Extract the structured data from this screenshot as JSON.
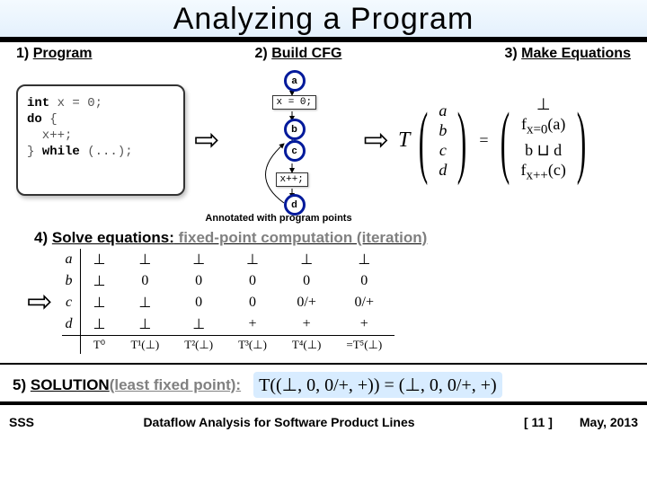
{
  "title": "Analyzing a Program",
  "h1": {
    "num": "1)",
    "text": "Program"
  },
  "h2": {
    "num": "2)",
    "text": "Build CFG"
  },
  "h3": {
    "num": "3)",
    "text": "Make Equations"
  },
  "code": {
    "l1a": "int",
    "l1b": " x = 0;",
    "l2a": "do",
    "l2b": " {",
    "l3": "  x++;",
    "l4a": "} ",
    "l4b": "while",
    "l4c": " (...);"
  },
  "cfg": {
    "labels": {
      "a": "a",
      "b": "b",
      "c": "c",
      "d": "d"
    },
    "stmt1": "x = 0;",
    "stmt2": "x++;"
  },
  "annotated_caption": "Annotated with program points",
  "eq": {
    "T": "T",
    "vec": [
      "a",
      "b",
      "c",
      "d"
    ],
    "equals": "=",
    "rhs": [
      "⊥",
      "f_{x=0}(a)",
      "b ⊔ d",
      "f_{x++}(c)"
    ]
  },
  "h4": {
    "num": "4)",
    "text_a": "Solve equations:",
    "text_b": " fixed-point computation (iteration)"
  },
  "iter": {
    "rows": [
      "a",
      "b",
      "c",
      "d"
    ],
    "data": [
      [
        "⊥",
        "⊥",
        "⊥",
        "⊥",
        "⊥",
        "⊥"
      ],
      [
        "⊥",
        "0",
        "0",
        "0",
        "0",
        "0"
      ],
      [
        "⊥",
        "⊥",
        "0",
        "0",
        "0/+",
        "0/+"
      ],
      [
        "⊥",
        "⊥",
        "⊥",
        "+",
        "+",
        "+"
      ]
    ],
    "collabels": [
      "T⁰",
      "T¹(⊥)",
      "T²(⊥)",
      "T³(⊥)",
      "T⁴(⊥)",
      "=T⁵(⊥)"
    ]
  },
  "h5": {
    "num": "5)",
    "text_a": "SOLUTION",
    "text_b": " (least fixed point):"
  },
  "solution_eq": "T((⊥, 0, 0/+, +)) = (⊥, 0, 0/+, +)",
  "footer": {
    "left": "SSS",
    "center": "Dataflow Analysis for Software Product Lines",
    "page": "[ 11 ]",
    "right": "May, 2013"
  }
}
